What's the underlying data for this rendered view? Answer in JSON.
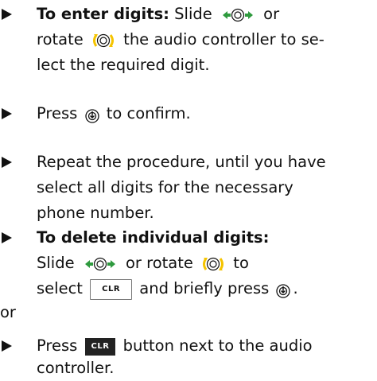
{
  "steps": [
    {
      "lines": [
        {
          "bold": "To enter digits:",
          "t1": " Slide ",
          "t2": " or"
        },
        {
          "t1": "rotate ",
          "t2": " the audio controller to se-"
        },
        {
          "t1": "lect the required digit."
        }
      ]
    },
    {
      "lines": [
        {
          "t1": "Press ",
          "t2": " to confirm."
        }
      ]
    },
    {
      "lines": [
        {
          "t1": "Repeat the procedure, until you have"
        },
        {
          "t1": "select all digits for the necessary"
        },
        {
          "t1": "phone number."
        }
      ]
    },
    {
      "lines": [
        {
          "bold": "To delete individual digits:"
        },
        {
          "t1": "Slide ",
          "t2": " or rotate ",
          "t3": " to"
        },
        {
          "t1": "select ",
          "t2": " and briefly press ",
          "t3": "."
        }
      ]
    },
    {
      "lines": [
        {
          "t1": "Press ",
          "t2": " button next to the audio"
        },
        {
          "t1": "controller."
        }
      ]
    }
  ],
  "or_text": "or",
  "keys": {
    "clr_label": "CLR"
  },
  "colors": {
    "arrow_green": "#2e9a3e",
    "rotate_yellow": "#f5c400",
    "text": "#111111"
  },
  "icons": {
    "slide": "slide-left-right-controller-icon",
    "rotate": "rotate-controller-icon",
    "press": "press-controller-icon"
  }
}
